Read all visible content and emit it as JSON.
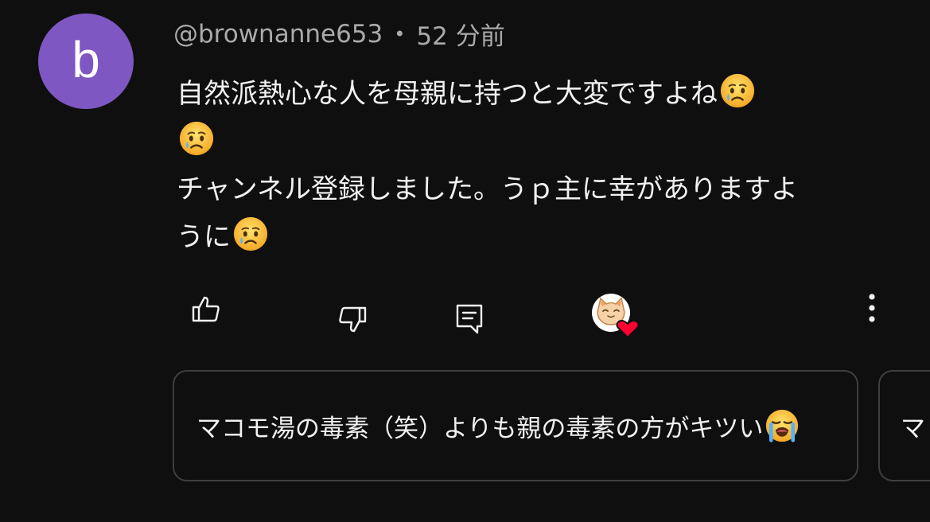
{
  "comment": {
    "avatar_letter": "b",
    "avatar_color": "#7e57c2",
    "username": "@brownanne653",
    "separator": "•",
    "time": "52 分前",
    "lines": [
      "自然派熱心な人を母親に持つと大変ですよね",
      "",
      "チャンネル登録しました。うｐ主に幸がありますよ",
      "うに"
    ],
    "emoji": "crying-face"
  },
  "actions": {
    "like_icon": "thumbs-up-icon",
    "dislike_icon": "thumbs-down-icon",
    "reply_icon": "reply-icon",
    "creator_heart_icon": "creator-heart-icon",
    "more_icon": "more-vertical-icon"
  },
  "replies": [
    {
      "text": "マコモ湯の毒素（笑）よりも親の毒素の方がキツい",
      "emoji": "loudly-crying-face"
    },
    {
      "text": "マ"
    }
  ],
  "colors": {
    "background": "#0f0f0f",
    "text": "#f1f1f1",
    "secondary_text": "#aaaaaa",
    "card_border": "#3f3f3f",
    "heart": "#ff0033"
  }
}
